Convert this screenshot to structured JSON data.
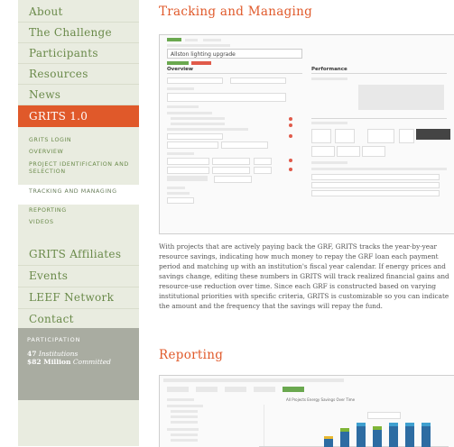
{
  "sidebar": {
    "items_top": [
      "About",
      "The Challenge",
      "Participants",
      "Resources",
      "News"
    ],
    "active": "GRITS 1.0",
    "sub_items": [
      "GRITS LOGIN",
      "OVERVIEW",
      "PROJECT IDENTIFICATION AND SELECTION",
      "TRACKING AND MANAGING",
      "REPORTING",
      "VIDEOS"
    ],
    "current_sub": "TRACKING AND MANAGING",
    "items_bottom": [
      "GRITS Affiliates",
      "Events",
      "LEEF Network",
      "Contact"
    ],
    "participation": {
      "title": "PARTICIPATION",
      "line1_number": "47",
      "line1_text": "Institutions",
      "line2_number": "$82 Million",
      "line2_text": "Committed"
    }
  },
  "main": {
    "section1_title": "Tracking and Managing",
    "screenshot1": {
      "project_name": "Allston lighting upgrade",
      "left_header": "Overview",
      "right_header": "Performance"
    },
    "paragraph": "With projects that are actively paying back the GRF, GRITS tracks the year-by-year resource savings, indicating how much money to repay the GRF loan each payment period and matching up with an institution's fiscal year calendar. If energy prices and savings change, editing these numbers in GRITS will track realized financial gains and resource-use reduction over time. Since each GRF is constructed based on varying institutional priorities with specific criteria, GRITS is customizable so you can indicate the amount and the frequency that the savings will repay the fund.",
    "section2_title": "Reporting",
    "screenshot2": {
      "chart_title": "All Projects Energy Savings Over Time"
    }
  },
  "colors": {
    "accent": "#e0592a",
    "link": "#6a8a4a",
    "sidebar_bg": "#e9ece0",
    "participation_bg": "#a9aca1"
  }
}
